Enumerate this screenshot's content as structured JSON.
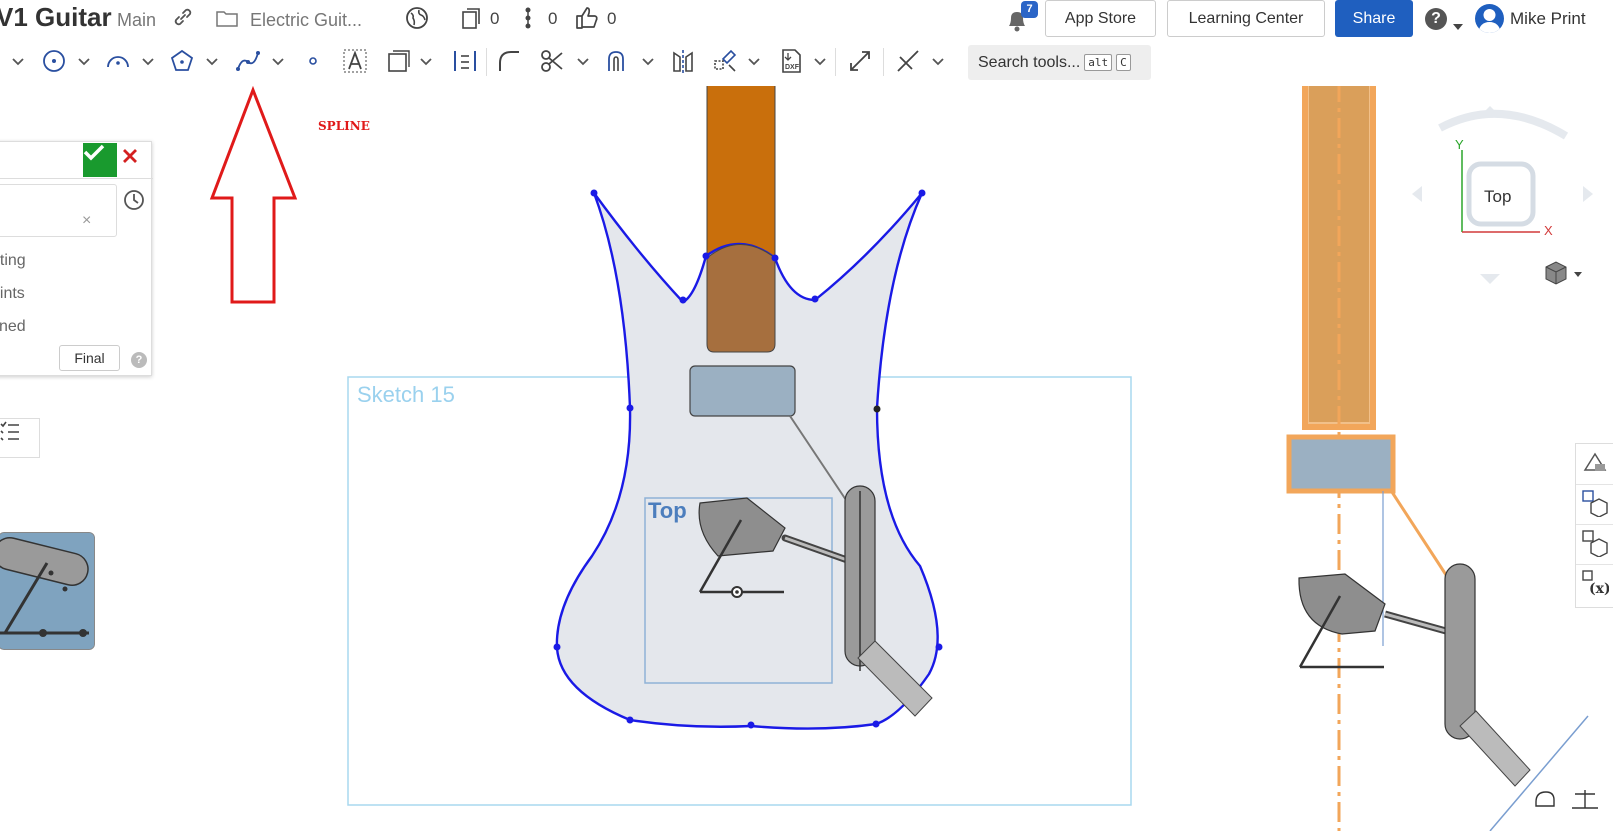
{
  "header": {
    "doc_title": "V1 Guitar",
    "branch": "Main",
    "folder": "Electric Guit...",
    "versions_count": "0",
    "branches_count": "0",
    "likes_count": "0",
    "notifications_count": "7",
    "app_store": "App Store",
    "learning_center": "Learning Center",
    "share": "Share",
    "user_name": "Mike Print"
  },
  "toolbar": {
    "search_placeholder": "Search tools...",
    "shortcut_key_1": "alt",
    "shortcut_key_2": "C"
  },
  "annotation": {
    "label": "SPLINE"
  },
  "canvas": {
    "sketch_label": "Sketch 15",
    "plane_label": "Top"
  },
  "dialog": {
    "items": [
      "nting",
      "aints",
      "fined"
    ],
    "final_button": "Final",
    "help": "?"
  },
  "viewcube": {
    "face_label": "Top",
    "axis_y": "Y",
    "axis_x": "X"
  },
  "colors": {
    "accent_blue": "#1f5fbf",
    "spline_blue": "#1a1ae6",
    "neck_orange": "#c96f0c",
    "annotation_red": "#e01a1a",
    "confirm_green": "#199a2e",
    "selection_orange": "#f2a65a"
  },
  "icons": [
    "link-icon",
    "folder-icon",
    "globe-icon",
    "versions-icon",
    "branch-icon",
    "like-icon",
    "bell-icon",
    "help-icon",
    "circle-tool-icon",
    "arc-tool-icon",
    "polygon-tool-icon",
    "spline-tool-icon",
    "point-tool-icon",
    "text-tool-icon",
    "construction-icon",
    "dimension-icon",
    "fillet-icon",
    "trim-icon",
    "offset-icon",
    "mirror-icon",
    "pattern-icon",
    "dxf-icon",
    "transform-icon",
    "constraint-icon"
  ]
}
